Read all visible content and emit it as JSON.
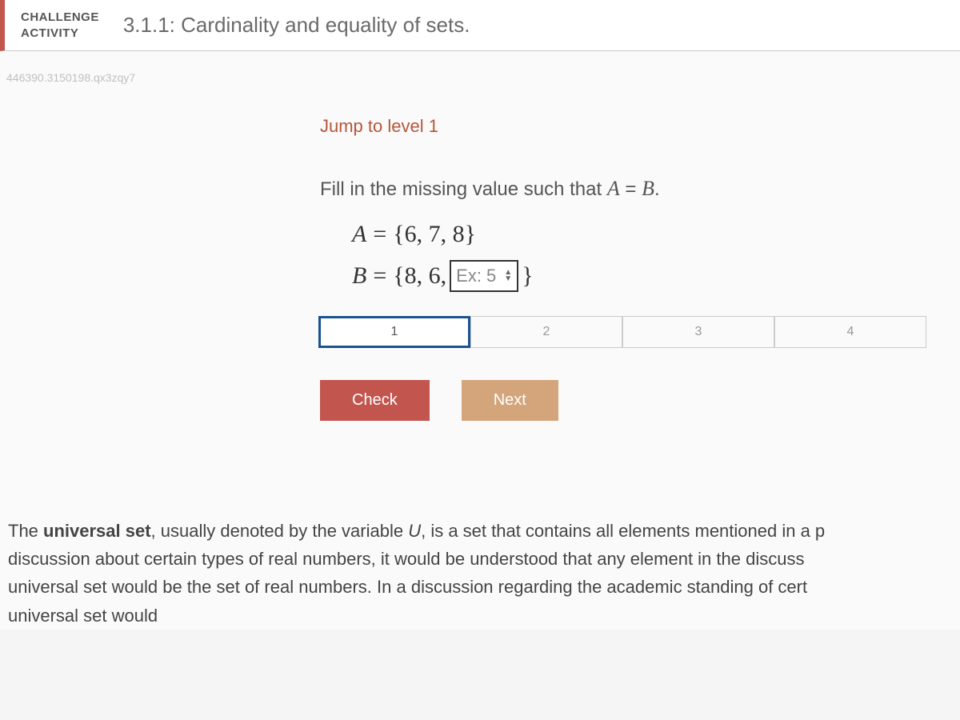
{
  "header": {
    "label_line1": "CHALLENGE",
    "label_line2": "ACTIVITY",
    "title": "3.1.1: Cardinality and equality of sets."
  },
  "watermark": "446390.3150198.qx3zqy7",
  "jump_link": "Jump to level 1",
  "question": {
    "prompt_prefix": "Fill in the missing value such that ",
    "var_a": "A",
    "equals": " = ",
    "var_b": "B",
    "period": "."
  },
  "equations": {
    "a_var": "A",
    "a_eq": "=",
    "a_set": "{6, 7, 8}",
    "b_var": "B",
    "b_eq": "=",
    "b_open": "{8, 6,",
    "b_close": "}",
    "input_placeholder": "Ex: 5"
  },
  "steps": [
    "1",
    "2",
    "3",
    "4"
  ],
  "buttons": {
    "check": "Check",
    "next": "Next"
  },
  "footer": {
    "line1_pre": "The ",
    "line1_bold": "universal set",
    "line1_mid": ", usually denoted by the variable ",
    "line1_var": "U",
    "line1_post": ", is a set that contains all elements mentioned in a p",
    "line2": "discussion about certain types of real numbers, it would be understood that any element in the discuss",
    "line3": "universal set would be the set of real numbers. In a discussion regarding the academic standing of cert",
    "line4": "universal set would"
  }
}
